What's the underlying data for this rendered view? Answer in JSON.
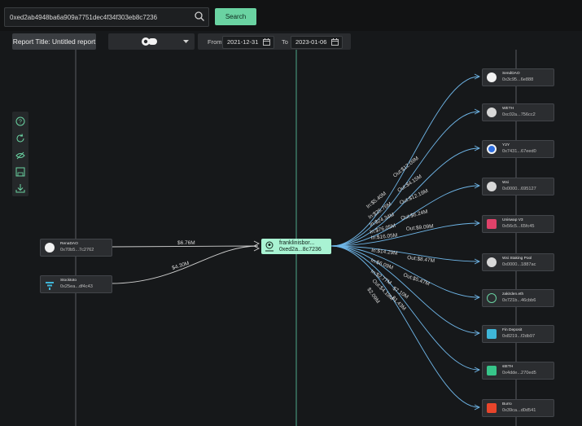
{
  "search": {
    "value": "0xed2ab4948ba6a909a7751dec4f34f303eb8c7236",
    "button": "Search"
  },
  "toolbar": {
    "report_title": "Report Title: Untitled report",
    "from_label": "From",
    "from_date": "2021-12-31",
    "to_label": "To",
    "to_date": "2023-01-06"
  },
  "center": {
    "name": "franklinisbor...",
    "address": "0xed2a...8c7236"
  },
  "sources": [
    {
      "name": "RenaDAO",
      "address": "0x70b5...7c2762",
      "amount": "$6.76M",
      "icon": "link-icon"
    },
    {
      "name": "Stocktoto",
      "address": "0x25ea...df4c43",
      "amount": "$4.30M",
      "icon": "tree-icon"
    }
  ],
  "targets": [
    {
      "name": "SendDAO",
      "address": "0x3c95...6e888",
      "icon": "link-icon"
    },
    {
      "name": "WETH",
      "address": "0xc02a...756cc2",
      "icon": "doc-icon"
    },
    {
      "name": "Y2Y",
      "address": "0x7431...67eed0",
      "icon": "circle-icon"
    },
    {
      "name": "Wxi",
      "address": "0x0000...695127",
      "icon": "doc-icon"
    },
    {
      "name": "Uniswap V3",
      "address": "0x56c5...65fc45",
      "icon": "triangle-icon"
    },
    {
      "name": "Wxi Staking Pool",
      "address": "0x0000...1887ac",
      "icon": "doc-icon"
    },
    {
      "name": "zakirden.eth",
      "address": "0x721b...46cbb6",
      "icon": "user-icon"
    },
    {
      "name": "Fin Deposit",
      "address": "0x8219...f2db97",
      "icon": "tree-icon"
    },
    {
      "name": "stETH",
      "address": "0x4dde...270ed5",
      "icon": "stack-icon"
    },
    {
      "name": "Burro",
      "address": "0x39ca...d0d541",
      "icon": "burro-icon"
    }
  ],
  "edge_labels": [
    "In:$5.40M",
    "Out:$12.09M",
    "In:$35.76M",
    "Out:$4.15M",
    "In:$24.34M",
    "Out:$12.19M",
    "In:$76.05M",
    "Out:$6.24M",
    "In:$16.05M",
    "Out:$9.09M",
    "In:$14.29M",
    "Out:$8.47M",
    "In:$6.09M",
    "Out:$5.47M",
    "In:$2.77M",
    "$7.10M",
    "Out:$4.19M",
    "$1.43M",
    "$2.09M"
  ],
  "colors": {
    "accent": "#6ad3a2",
    "center_bg": "#a9f3d3",
    "edge_out": "#6fb6e8",
    "edge_in": "#cfcfcf"
  }
}
